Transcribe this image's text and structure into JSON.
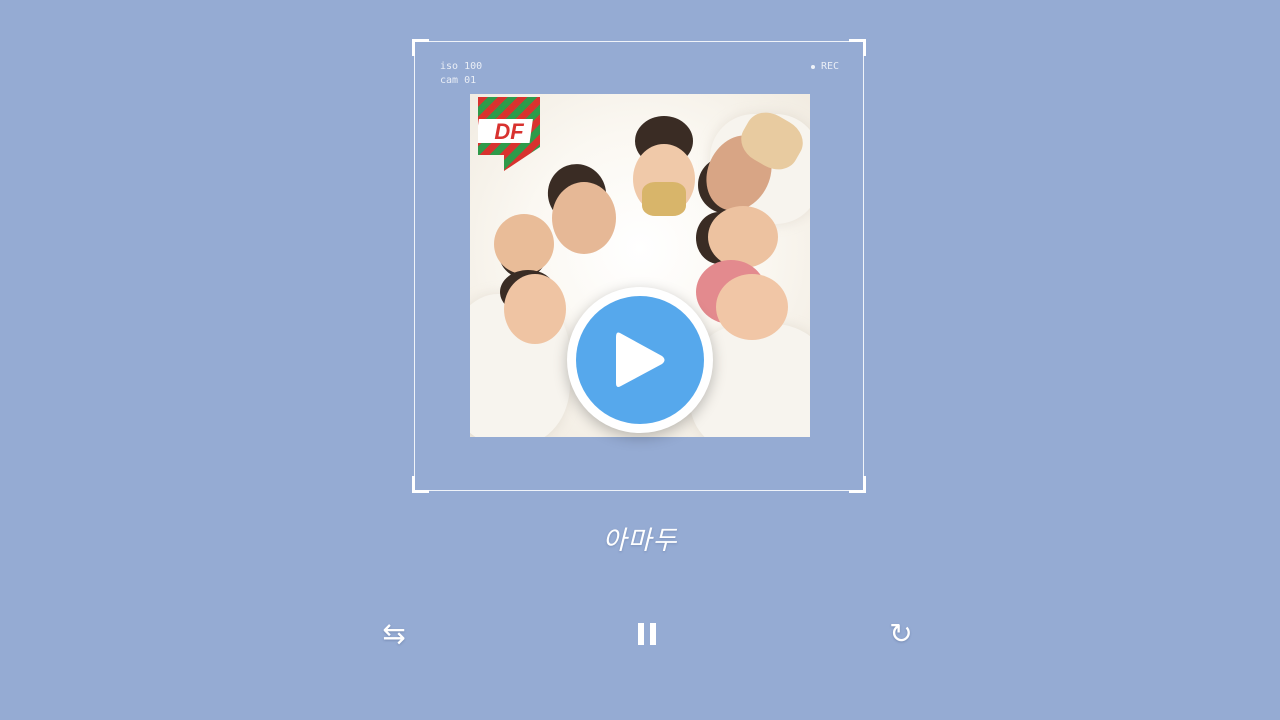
{
  "camera": {
    "iso": "iso 100",
    "cam": "cam 01",
    "rec_label": "REC"
  },
  "album": {
    "logo_text": "DF",
    "logo_colors": [
      "#d8322f",
      "#2e9a4a"
    ]
  },
  "player": {
    "song_title": "아마두",
    "play_icon": "play-icon",
    "accent_color": "#56a8ec",
    "background_color": "#95abd3",
    "controls": {
      "shuffle_glyph": "⇆",
      "pause_glyph": "❚❚",
      "repeat_glyph": "↻"
    }
  }
}
